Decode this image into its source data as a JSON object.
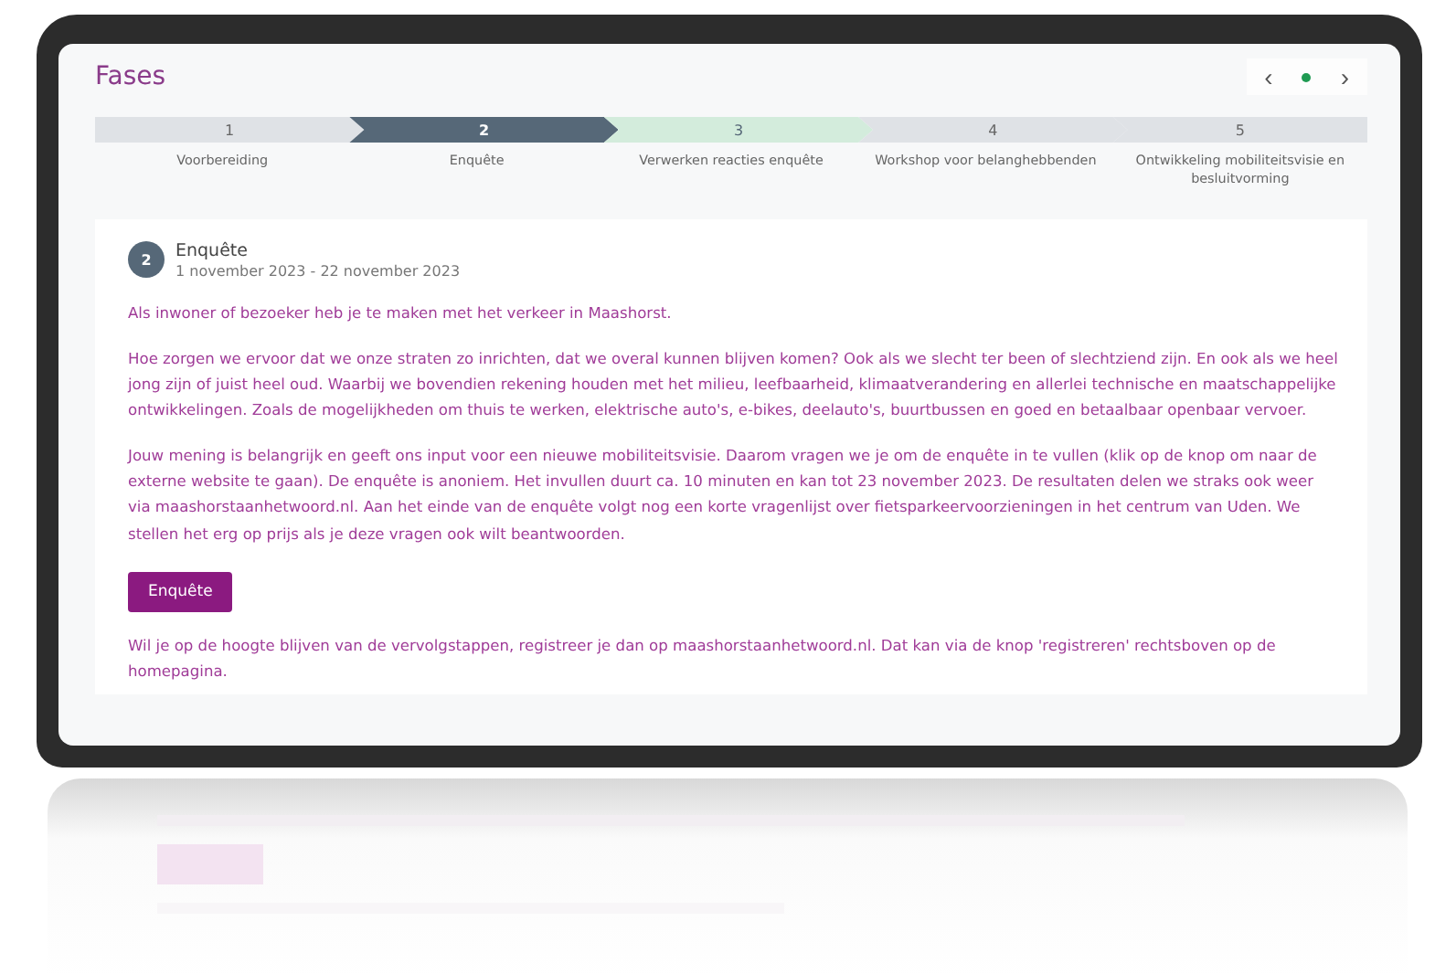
{
  "title": "Fases",
  "carousel": {
    "prev": "‹",
    "next": "›",
    "dots": [
      {
        "selected": true
      }
    ]
  },
  "steps": [
    {
      "number": "1",
      "label": "Voorbereiding",
      "kind": "done"
    },
    {
      "number": "2",
      "label": "Enquête",
      "kind": "current"
    },
    {
      "number": "3",
      "label": "Verwerken reacties enquête",
      "kind": "next"
    },
    {
      "number": "4",
      "label": "Workshop voor belanghebbenden",
      "kind": "future"
    },
    {
      "number": "5",
      "label": "Ontwikkeling mobiliteitsvisie en besluitvorming",
      "kind": "future"
    }
  ],
  "phase": {
    "badge": "2",
    "title": "Enquête",
    "dates": "1 november 2023 - 22 november 2023",
    "paragraphs": [
      "Als inwoner of bezoeker heb je te maken met het verkeer in Maashorst.",
      "Hoe zorgen we ervoor dat we onze straten zo inrichten, dat we overal kunnen blijven komen? Ook als we slecht ter been of slechtziend zijn. En ook als we heel jong zijn of juist heel oud. Waarbij we bovendien rekening houden met het milieu, leefbaarheid, klimaatverandering en allerlei technische en maatschappelijke ontwikkelingen. Zoals de mogelijkheden om thuis te werken, elektrische auto's, e-bikes, deelauto's, buurtbussen en goed en betaalbaar openbaar vervoer.",
      "Jouw mening is belangrijk en geeft ons input voor een nieuwe mobiliteitsvisie. Daarom vragen we je om de enquête in te vullen (klik op de knop om naar de externe website te gaan). De enquête is anoniem. Het invullen duurt ca. 10 minuten en kan tot 23 november 2023. De resultaten delen we straks ook weer via maashorstaanhetwoord.nl. Aan het einde van de enquête volgt nog een korte vragenlijst over fietsparkeervoorzieningen in het centrum van Uden. We stellen het erg op prijs als je deze vragen ook wilt beantwoorden."
    ],
    "button": "Enquête",
    "footer": "Wil je op de hoogte blijven van de vervolgstappen, registreer je dan op maashorstaanhetwoord.nl. Dat kan via de knop 'registreren' rechtsboven op de homepagina."
  }
}
